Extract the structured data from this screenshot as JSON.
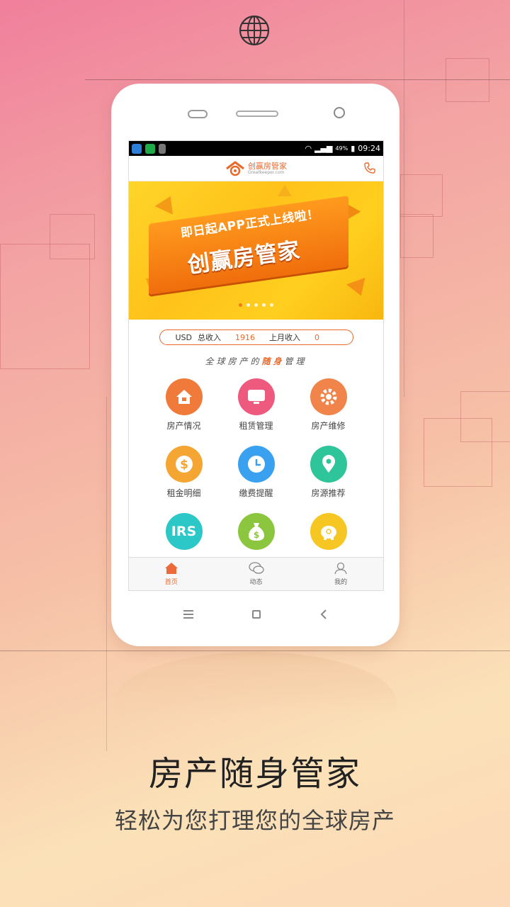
{
  "status_bar": {
    "battery": "49%",
    "time": "09:24"
  },
  "app": {
    "name": "创赢房管家",
    "subtitle": "Greatkeeper.com"
  },
  "banner": {
    "line1": "即日起APP正式上线啦！",
    "line2": "创赢房管家",
    "slides": 5,
    "active_slide": 1
  },
  "income": {
    "currency": "USD",
    "total_label": "总收入",
    "total_value": "1916",
    "last_month_label": "上月收入",
    "last_month_value": "0"
  },
  "slogan": {
    "before": "全球房产的",
    "highlight": "随身",
    "after": "管理"
  },
  "features": [
    {
      "label": "房产情况",
      "icon": "house-icon",
      "color": "#f07a3a"
    },
    {
      "label": "租赁管理",
      "icon": "tv-icon",
      "color": "#ee5a7e"
    },
    {
      "label": "房产维修",
      "icon": "gear-icon",
      "color": "#f0844a"
    },
    {
      "label": "租金明细",
      "icon": "dollar-icon",
      "color": "#f4a532"
    },
    {
      "label": "缴费提醒",
      "icon": "clock-icon",
      "color": "#3aa0f0"
    },
    {
      "label": "房源推荐",
      "icon": "location-pin-icon",
      "color": "#2fc59a"
    },
    {
      "label": "",
      "icon": "irs-icon",
      "icon_text": "IRS",
      "color": "#2cc8c8"
    },
    {
      "label": "",
      "icon": "money-bag-icon",
      "color": "#8cc63e"
    },
    {
      "label": "",
      "icon": "piggy-bank-icon",
      "color": "#f6c623"
    }
  ],
  "tabs": [
    {
      "label": "首页",
      "icon": "home-icon",
      "active": true
    },
    {
      "label": "动态",
      "icon": "chat-icon",
      "active": false
    },
    {
      "label": "我的",
      "icon": "user-icon",
      "active": false
    }
  ],
  "headline": "房产随身管家",
  "subline": "轻松为您打理您的全球房产"
}
